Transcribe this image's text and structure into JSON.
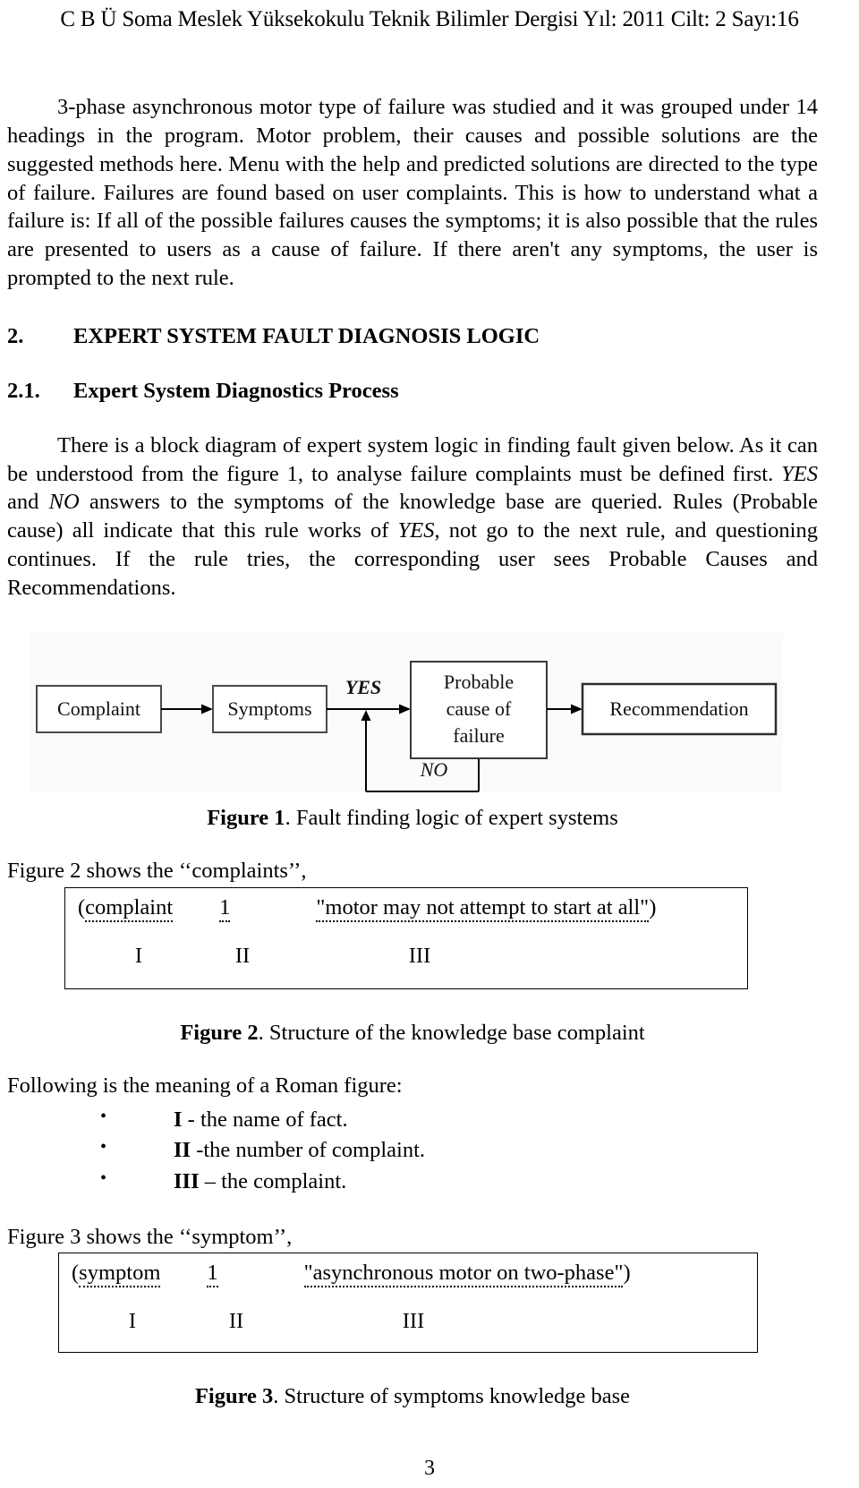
{
  "header": {
    "running_head": "C B Ü Soma Meslek Yüksekokulu Teknik Bilimler Dergisi Yıl: 2011 Cilt: 2 Sayı:16"
  },
  "paragraphs": {
    "intro_p1_a": "3-phase asynchronous motor type of failure was studied and it was grouped under 14 headings in the program.  Motor problem, their causes and possible solutions are the suggested methods here.  Menu with the help and predicted solutions are directed to the type of failure.  Failures are found based on user complaints.  This is how to understand what a failure is:  If all of the possible failures causes the symptoms; it is also possible that the rules are presented to users as a cause of failure.  If there aren't any symptoms, the user is prompted to the next rule.",
    "diag_p_part1": "There is a block diagram of expert system logic in finding fault given below.  As it can be understood from the figure 1, to analyse failure complaints must be defined first.  ",
    "diag_p_yes1": "YES",
    "diag_p_part2": " and ",
    "diag_p_no1": "NO",
    "diag_p_part3": " answers to the symptoms of the knowledge base are queried.  Rules (Probable cause) all indicate that this rule works of ",
    "diag_p_yes2": "YES",
    "diag_p_part4": ", not go to the next rule, and questioning continues.  If the rule tries, the corresponding user sees Probable Causes and Recommendations."
  },
  "headings": {
    "section2_num": "2.",
    "section2_title": "EXPERT SYSTEM FAULT DIAGNOSIS LOGIC",
    "section21_num": "2.1.",
    "section21_title": "Expert System Diagnostics Process"
  },
  "figure1": {
    "boxes": {
      "complaint": "Complaint",
      "symptoms": "Symptoms",
      "probable_line1": "Probable",
      "probable_line2": "cause of",
      "probable_line3": "failure",
      "recommendation": "Recommendation"
    },
    "labels": {
      "yes": "YES",
      "no": "NO"
    },
    "caption_bold": "Figure 1",
    "caption_rest": ". Fault finding logic of expert systems"
  },
  "figure2": {
    "lead_in": "Figure 2 shows the  ‘‘complaints’’,",
    "open_paren": "(",
    "field_name": "complaint",
    "field_number": "1",
    "quoted_value": "\"motor may not attempt to start at all\"",
    "close_paren": ")",
    "roman_i": "I",
    "roman_ii": "II",
    "roman_iii": "III",
    "caption_bold": "Figure 2",
    "caption_rest": ". Structure of the knowledge base complaint"
  },
  "roman_meaning": {
    "intro": "Following is the meaning of a Roman figure:",
    "items": [
      {
        "roman": "I",
        "text": " - the name of fact."
      },
      {
        "roman": "II",
        "text": " -the number of complaint."
      },
      {
        "roman": "III",
        "text": " – the complaint."
      }
    ],
    "bullet_glyph": "•"
  },
  "figure3": {
    "lead_in": "Figure 3 shows the  ‘‘symptom’’,",
    "open_paren": "(",
    "field_name": "symptom",
    "field_number": "1",
    "quoted_value": "\"asynchronous motor on two-phase\"",
    "close_paren": ")",
    "roman_i": "I",
    "roman_ii": "II",
    "roman_iii": "III",
    "caption_bold": "Figure 3",
    "caption_rest": ". Structure of symptoms knowledge base"
  },
  "footer": {
    "page_number": "3"
  }
}
